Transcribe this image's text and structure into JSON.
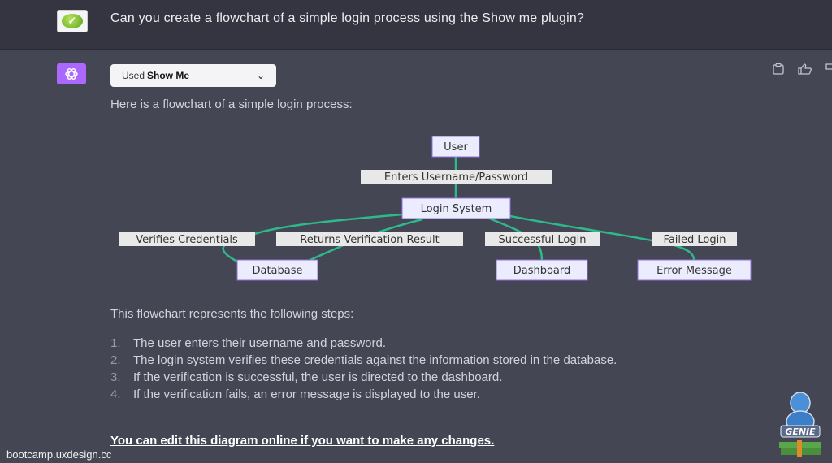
{
  "user_message": {
    "avatar": "green-check-avatar",
    "text": "Can you create a flowchart of a simple login process using the Show me plugin?"
  },
  "assistant": {
    "avatar": "chatgpt-logo-icon",
    "plugin_pill": {
      "prefix": "Used",
      "name": "Show Me",
      "icon": "chevron-down-icon"
    },
    "actions": [
      "copy-icon",
      "thumbs-up-icon",
      "thumbs-down-icon"
    ],
    "intro": "Here is a flowchart of a simple login process:",
    "diagram": {
      "nodes": [
        {
          "id": "user",
          "label": "User"
        },
        {
          "id": "login",
          "label": "Login System"
        },
        {
          "id": "db",
          "label": "Database"
        },
        {
          "id": "dash",
          "label": "Dashboard"
        },
        {
          "id": "err",
          "label": "Error Message"
        }
      ],
      "edges": [
        {
          "from": "user",
          "to": "login",
          "label": "Enters Username/Password"
        },
        {
          "from": "login",
          "to": "db",
          "label": "Verifies Credentials"
        },
        {
          "from": "db",
          "to": "login",
          "label": "Returns Verification Result"
        },
        {
          "from": "login",
          "to": "dash",
          "label": "Successful Login"
        },
        {
          "from": "login",
          "to": "err",
          "label": "Failed Login"
        }
      ],
      "edge_color": "#2dba8a",
      "node_fill": "#ececff"
    },
    "steps_title": "This flowchart represents the following steps:",
    "steps": [
      {
        "num": "1.",
        "text": "The user enters their username and password."
      },
      {
        "num": "2.",
        "text": "The login system verifies these credentials against the information stored in the database."
      },
      {
        "num": "3.",
        "text": "If the verification is successful, the user is directed to the dashboard."
      },
      {
        "num": "4.",
        "text": "If the verification fails, an error message is displayed to the user."
      }
    ],
    "edit_link": "You can edit this diagram online if you want to make any changes."
  },
  "watermark": "bootcamp.uxdesign.cc",
  "genie_logo_text": "GENIE"
}
